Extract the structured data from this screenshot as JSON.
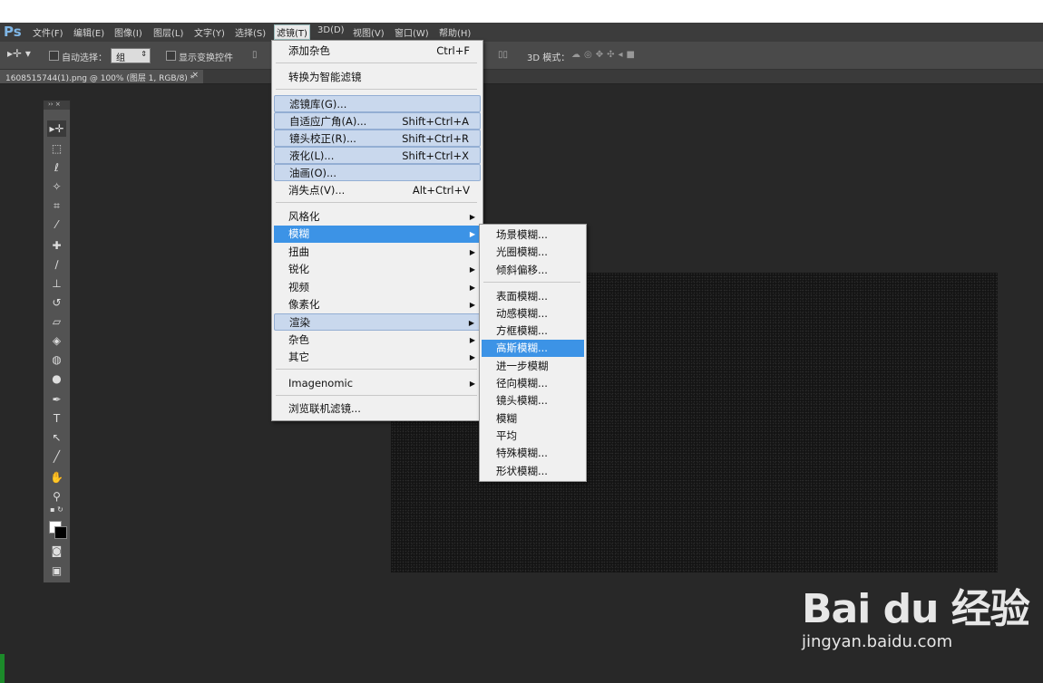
{
  "app": {
    "logo": "Ps"
  },
  "menubar": {
    "items": [
      "文件(F)",
      "编辑(E)",
      "图像(I)",
      "图层(L)",
      "文字(Y)",
      "选择(S)",
      "滤镜(T)",
      "3D(D)",
      "视图(V)",
      "窗口(W)",
      "帮助(H)"
    ],
    "active": "滤镜(T)"
  },
  "options": {
    "auto_select_label": "自动选择：",
    "auto_select_value": "组",
    "show_transform_label": "显示变换控件",
    "mode_3d_label": "3D 模式："
  },
  "document_tab": {
    "title": "1608515744(1).png @ 100% (图层 1, RGB/8) *",
    "close": "×"
  },
  "filter_menu": {
    "items": [
      {
        "label": "添加杂色",
        "shortcut": "Ctrl+F"
      },
      {
        "label": "转换为智能滤镜",
        "shortcut": ""
      },
      {
        "label": "滤镜库(G)...",
        "shortcut": ""
      },
      {
        "label": "自适应广角(A)...",
        "shortcut": "Shift+Ctrl+A"
      },
      {
        "label": "镜头校正(R)...",
        "shortcut": "Shift+Ctrl+R"
      },
      {
        "label": "液化(L)...",
        "shortcut": "Shift+Ctrl+X"
      },
      {
        "label": "油画(O)...",
        "shortcut": ""
      },
      {
        "label": "消失点(V)...",
        "shortcut": "Alt+Ctrl+V"
      },
      {
        "label": "风格化",
        "shortcut": ""
      },
      {
        "label": "模糊",
        "shortcut": ""
      },
      {
        "label": "扭曲",
        "shortcut": ""
      },
      {
        "label": "锐化",
        "shortcut": ""
      },
      {
        "label": "视频",
        "shortcut": ""
      },
      {
        "label": "像素化",
        "shortcut": ""
      },
      {
        "label": "渲染",
        "shortcut": ""
      },
      {
        "label": "杂色",
        "shortcut": ""
      },
      {
        "label": "其它",
        "shortcut": ""
      },
      {
        "label": "Imagenomic",
        "shortcut": ""
      },
      {
        "label": "浏览联机滤镜...",
        "shortcut": ""
      }
    ]
  },
  "blur_submenu": {
    "items": [
      "场景模糊...",
      "光圈模糊...",
      "倾斜偏移...",
      "表面模糊...",
      "动感模糊...",
      "方框模糊...",
      "高斯模糊...",
      "进一步模糊",
      "径向模糊...",
      "镜头模糊...",
      "模糊",
      "平均",
      "特殊模糊...",
      "形状模糊..."
    ],
    "selected": "高斯模糊..."
  },
  "watermark": {
    "brand": "Bai du 经验",
    "url": "jingyan.baidu.com"
  },
  "toolbox": {
    "header": "›› ×"
  }
}
